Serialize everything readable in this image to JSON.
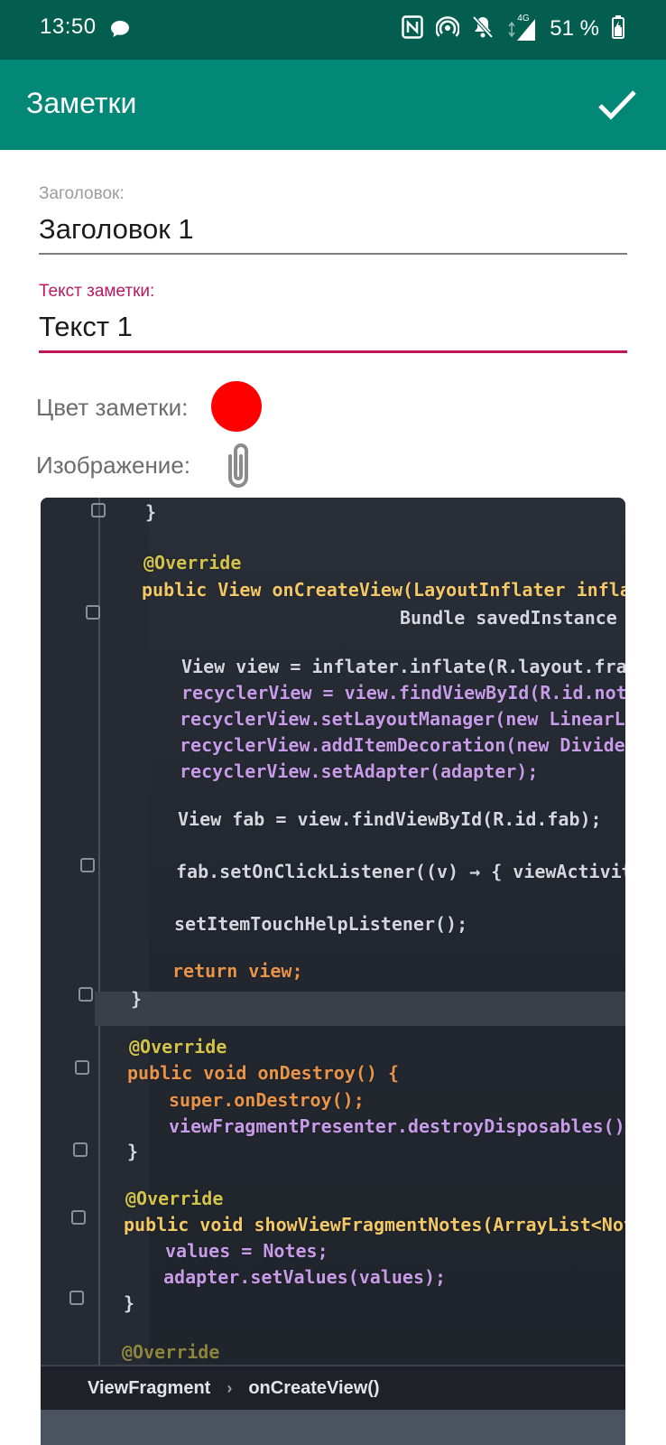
{
  "status_bar": {
    "time": "13:50",
    "network": "4G",
    "battery": "51 %",
    "icons": [
      "chat-icon",
      "nfc-icon",
      "hotspot-icon",
      "bell-off-icon",
      "signal-icon",
      "battery-icon"
    ]
  },
  "app_bar": {
    "title": "Заметки",
    "confirm_icon": "check-icon"
  },
  "form": {
    "title_label": "Заголовок:",
    "title_value": "Заголовок 1",
    "text_label": "Текст заметки:",
    "text_value": "Текст 1",
    "color_label": "Цвет заметки:",
    "color_value": "#ff0000",
    "image_label": "Изображение:",
    "image_icon": "paperclip-icon"
  },
  "image_preview": {
    "code_lines": [
      "}",
      "@Override",
      "public View onCreateView(LayoutInflater infla",
      "Bundle savedInstance",
      "View view = inflater.inflate(R.layout.fra",
      "recyclerView = view.findViewById(R.id.note",
      "recyclerView.setLayoutManager(new LinearLa",
      "recyclerView.addItemDecoration(new Divider",
      "recyclerView.setAdapter(adapter);",
      "View fab = view.findViewById(R.id.fab);",
      "fab.setOnClickListener((v) → { viewActivit",
      "setItemTouchHelpListener();",
      "return view;",
      "}",
      "@Override",
      "public void onDestroy() {",
      "super.onDestroy();",
      "viewFragmentPresenter.destroyDisposables();",
      "}",
      "@Override",
      "public void showViewFragmentNotes(ArrayList<Not",
      "values = Notes;",
      "adapter.setValues(values);",
      "}",
      "@Override"
    ],
    "breadcrumb": [
      "ViewFragment",
      "onCreateView()"
    ]
  }
}
